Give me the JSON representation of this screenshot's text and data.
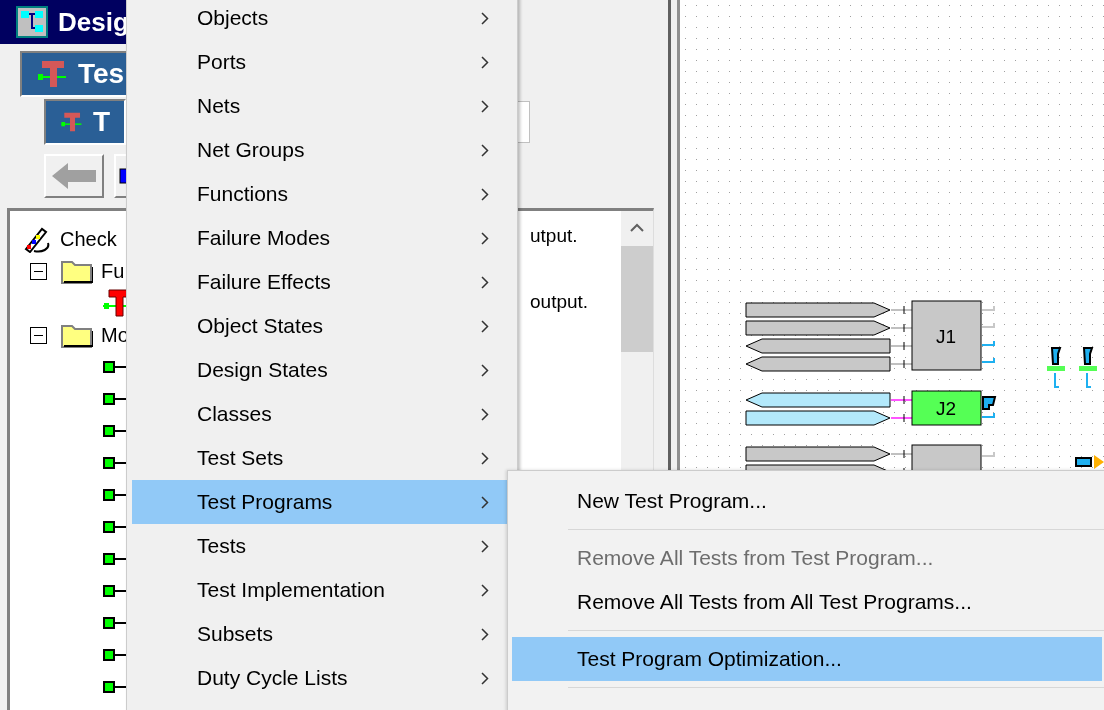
{
  "window": {
    "title": "Desig"
  },
  "breadcrumbs": [
    {
      "label": "Tes"
    },
    {
      "label": "T"
    }
  ],
  "tree": [
    {
      "kind": "check",
      "label": "Check",
      "children": [
        {
          "kind": "folder",
          "label": "Fu",
          "expanded": true,
          "children": [
            {
              "kind": "test"
            }
          ]
        },
        {
          "kind": "folder",
          "label": "Mo",
          "expanded": true,
          "children": [
            {
              "kind": "pin"
            },
            {
              "kind": "pin"
            },
            {
              "kind": "pin"
            },
            {
              "kind": "pin"
            },
            {
              "kind": "pin"
            },
            {
              "kind": "pin"
            },
            {
              "kind": "pin"
            },
            {
              "kind": "pin"
            },
            {
              "kind": "pin"
            },
            {
              "kind": "pin"
            },
            {
              "kind": "pin"
            }
          ]
        }
      ]
    }
  ],
  "descriptions": [
    "utput.",
    "output."
  ],
  "menu": {
    "items": [
      {
        "label": "Objects",
        "selected": false
      },
      {
        "label": "Ports",
        "selected": false
      },
      {
        "label": "Nets",
        "selected": false
      },
      {
        "label": "Net Groups",
        "selected": false
      },
      {
        "label": "Functions",
        "selected": false
      },
      {
        "label": "Failure Modes",
        "selected": false
      },
      {
        "label": "Failure Effects",
        "selected": false
      },
      {
        "label": "Object States",
        "selected": false
      },
      {
        "label": "Design States",
        "selected": false
      },
      {
        "label": "Classes",
        "selected": false
      },
      {
        "label": "Test Sets",
        "selected": false
      },
      {
        "label": "Test Programs",
        "selected": true
      },
      {
        "label": "Tests",
        "selected": false
      },
      {
        "label": "Test Implementation",
        "selected": false
      },
      {
        "label": "Subsets",
        "selected": false
      },
      {
        "label": "Duty Cycle Lists",
        "selected": false
      }
    ]
  },
  "submenu": {
    "items": [
      {
        "kind": "item",
        "label": "New Test Program...",
        "disabled": false,
        "selected": false
      },
      {
        "kind": "separator"
      },
      {
        "kind": "item",
        "label": "Remove All Tests from Test Program...",
        "disabled": true,
        "selected": false
      },
      {
        "kind": "item",
        "label": "Remove All Tests from All Test Programs...",
        "disabled": false,
        "selected": false
      },
      {
        "kind": "separator"
      },
      {
        "kind": "item",
        "label": "Test Program Optimization...",
        "disabled": false,
        "selected": true
      },
      {
        "kind": "separator"
      }
    ]
  },
  "canvas": {
    "blocks": [
      {
        "label": "J1",
        "color": "#c8c8c8"
      },
      {
        "label": "J2",
        "color": "#55ff55"
      },
      {
        "color": "#c8c8c8"
      }
    ]
  }
}
